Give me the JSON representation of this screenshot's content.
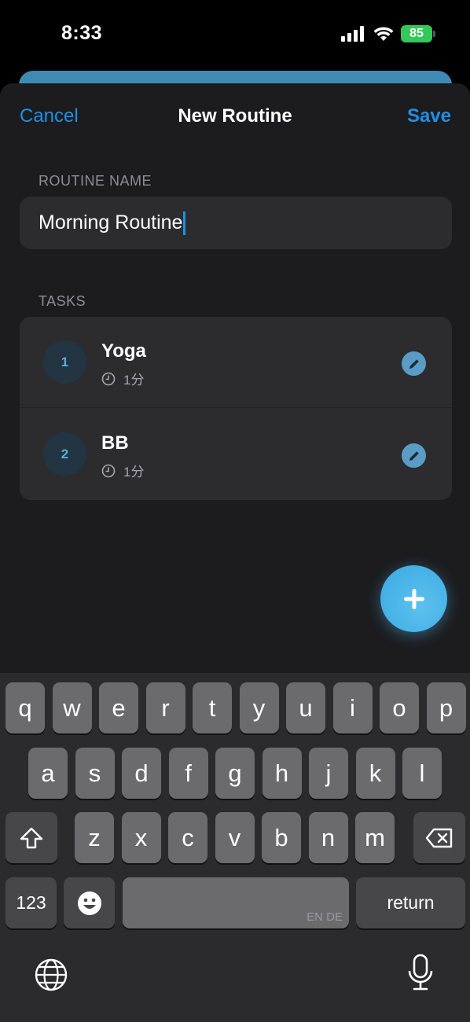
{
  "status_bar": {
    "time": "8:33",
    "battery": "85",
    "icons": [
      "signal-icon",
      "wifi-icon",
      "battery-icon"
    ]
  },
  "nav": {
    "cancel": "Cancel",
    "title": "New Routine",
    "save": "Save"
  },
  "routine_name": {
    "label": "ROUTINE NAME",
    "value": "Morning Routine"
  },
  "tasks": {
    "label": "TASKS",
    "items": [
      {
        "number": "1",
        "title": "Yoga",
        "duration": "1分"
      },
      {
        "number": "2",
        "title": "BB",
        "duration": "1分"
      }
    ]
  },
  "fab": {
    "icon": "plus-icon"
  },
  "keyboard": {
    "row1": [
      "q",
      "w",
      "e",
      "r",
      "t",
      "y",
      "u",
      "i",
      "o",
      "p"
    ],
    "row2": [
      "a",
      "s",
      "d",
      "f",
      "g",
      "h",
      "j",
      "k",
      "l"
    ],
    "row3": [
      "z",
      "x",
      "c",
      "v",
      "b",
      "n",
      "m"
    ],
    "numbers_key": "123",
    "return_key": "return",
    "space_languages": "EN DE"
  },
  "colors": {
    "accent": "#1f8fe6",
    "sheet_bg": "#1c1c1e",
    "card_bg": "#2c2c2e",
    "fab": "#4ab4e8"
  }
}
